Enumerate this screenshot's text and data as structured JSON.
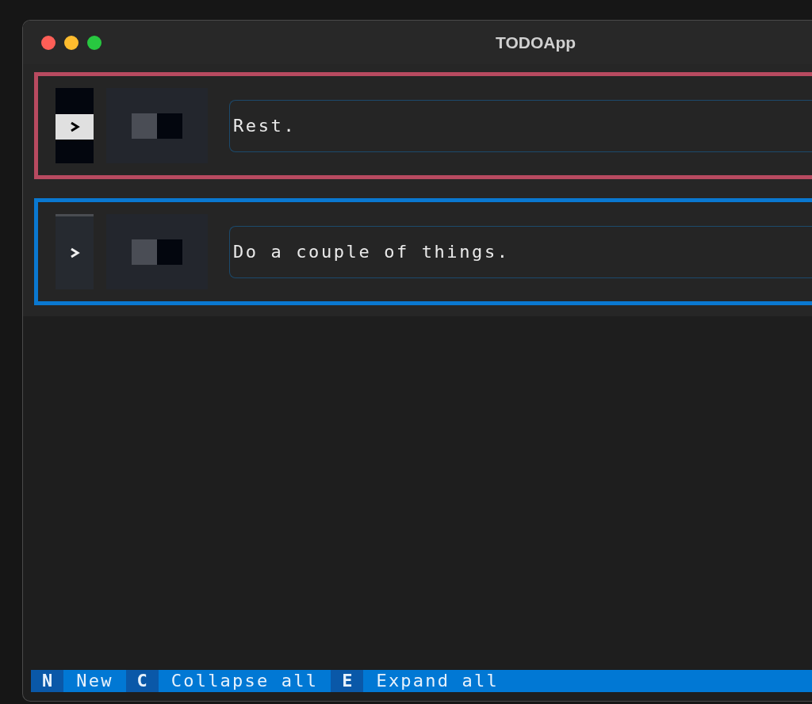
{
  "window": {
    "title": "TODOApp"
  },
  "tasks": [
    {
      "text": "Rest.",
      "focused": true,
      "expanded": false,
      "done": false
    },
    {
      "text": "Do a couple of things.",
      "focused": false,
      "expanded": false,
      "done": false
    }
  ],
  "footer": {
    "bindings": [
      {
        "key": "N",
        "label": "New"
      },
      {
        "key": "C",
        "label": "Collapse all"
      },
      {
        "key": "E",
        "label": "Expand all"
      }
    ]
  }
}
